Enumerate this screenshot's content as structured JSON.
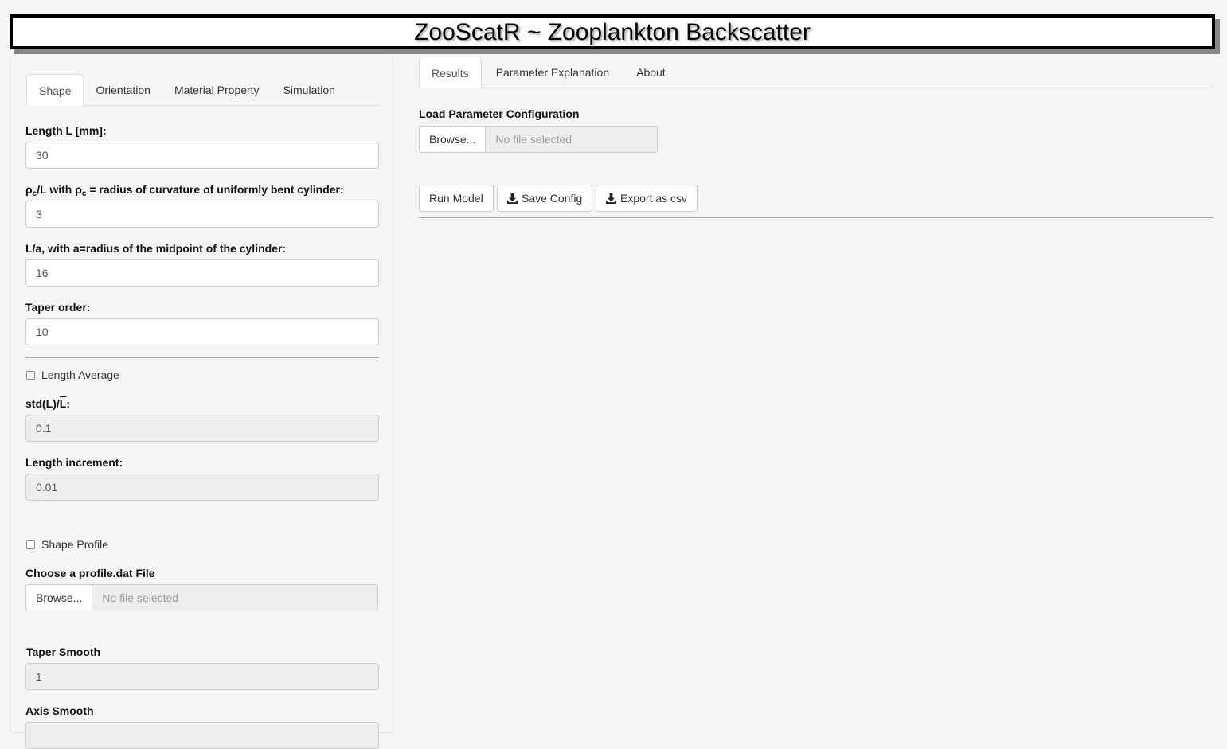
{
  "app_title": "ZooScatR ~ Zooplankton Backscatter",
  "sidebar": {
    "tabs": [
      "Shape",
      "Orientation",
      "Material Property",
      "Simulation"
    ],
    "active_tab": "Shape",
    "length_label": "Length L [mm]:",
    "length_value": "30",
    "rho_label_rho": "ρ",
    "rho_label_sub": "c",
    "rho_label_mid": "/L with ",
    "rho_label_rho2": "ρ",
    "rho_label_sub2": "c",
    "rho_label_end": " = radius of curvature of uniformly bent cylinder:",
    "rho_value": "3",
    "la_label": "L/a, with a=radius of the midpoint of the cylinder:",
    "la_value": "16",
    "taper_label": "Taper order:",
    "taper_value": "10",
    "length_average_label": "Length Average",
    "std_label_start": "std(L)/",
    "std_label_overline": "L",
    "std_label_end": ":",
    "std_value": "0.1",
    "length_increment_label": "Length increment:",
    "length_increment_value": "0.01",
    "shape_profile_label": "Shape Profile",
    "profile_file_label": "Choose a profile.dat File",
    "profile_browse": "Browse...",
    "profile_file_text": "No file selected",
    "taper_smooth_label": "Taper Smooth",
    "taper_smooth_value": "1",
    "axis_smooth_label": "Axis Smooth"
  },
  "main": {
    "tabs": [
      "Results",
      "Parameter Explanation",
      "About"
    ],
    "active_tab": "Results",
    "load_config_label": "Load Parameter Configuration",
    "config_browse": "Browse...",
    "config_file_text": "No file selected",
    "run_model": "Run Model",
    "save_config": "Save Config",
    "export_csv": "Export as csv"
  },
  "icons": {
    "download": "download-icon"
  }
}
